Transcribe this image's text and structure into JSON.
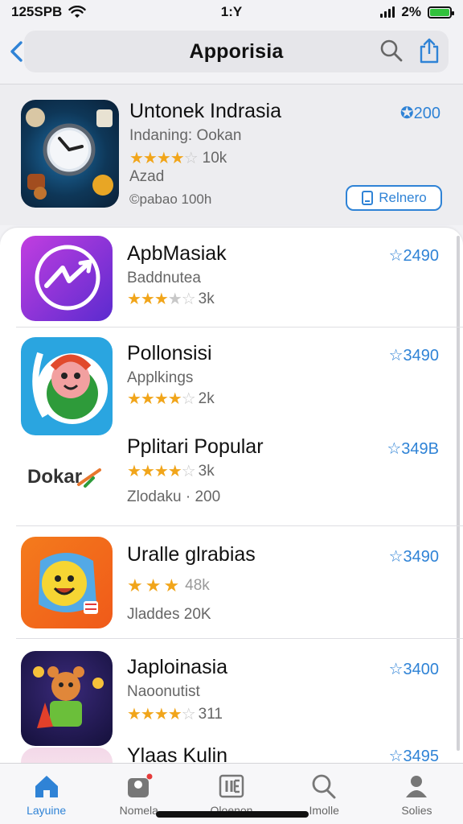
{
  "status": {
    "left_text": "125SPB",
    "time": "1:Y",
    "battery": "2%"
  },
  "nav": {
    "title": "Apporisia"
  },
  "featured": {
    "title": "Untonek Indrasia",
    "subtitle": "Indaning: Ookan",
    "rating_count": "10k",
    "tag": "Azad",
    "footer": "©pabao 100h",
    "price": "200",
    "button_label": "Relnero",
    "rating": 3.5
  },
  "apps": [
    {
      "title": "ApbMasiak",
      "subtitle": "Baddnutea",
      "rating_count": "3k",
      "extra": "",
      "price": "2490",
      "rating": 3.5
    },
    {
      "title": "Pollonsisi",
      "subtitle": "Applkings",
      "rating_count": "2k",
      "extra": "",
      "price": "3490",
      "rating": 3.5
    },
    {
      "title": "Pplitari Popular",
      "subtitle": "",
      "rating_count": "3k",
      "extra": "Zlodaku · 200",
      "price": "349B",
      "rating": 3.5,
      "icon_text": "Dokar"
    },
    {
      "title": "Uralle glrabias",
      "subtitle": "",
      "rating_count": "48k",
      "extra": "Jladdes 20K",
      "price": "3490",
      "rating": 3
    },
    {
      "title": "Japloinasia",
      "subtitle": "Naoonutist",
      "rating_count": "311",
      "extra": "",
      "price": "3400",
      "rating": 3.5
    },
    {
      "title": "Ylaas Kulin",
      "subtitle": "",
      "rating_count": "",
      "extra": "",
      "price": "3495",
      "rating": 0
    }
  ],
  "tabs": [
    {
      "label": "Layuine",
      "icon": "home-icon",
      "active": true
    },
    {
      "label": "Nomela",
      "icon": "games-icon",
      "active": false
    },
    {
      "label": "Oloenon",
      "icon": "apps-icon",
      "active": false
    },
    {
      "label": "Imolle",
      "icon": "search-icon",
      "active": false
    },
    {
      "label": "Solies",
      "icon": "profile-icon",
      "active": false
    }
  ],
  "colors": {
    "accent": "#2f83d6",
    "star": "#f1a51a",
    "battery": "#32c23c"
  }
}
